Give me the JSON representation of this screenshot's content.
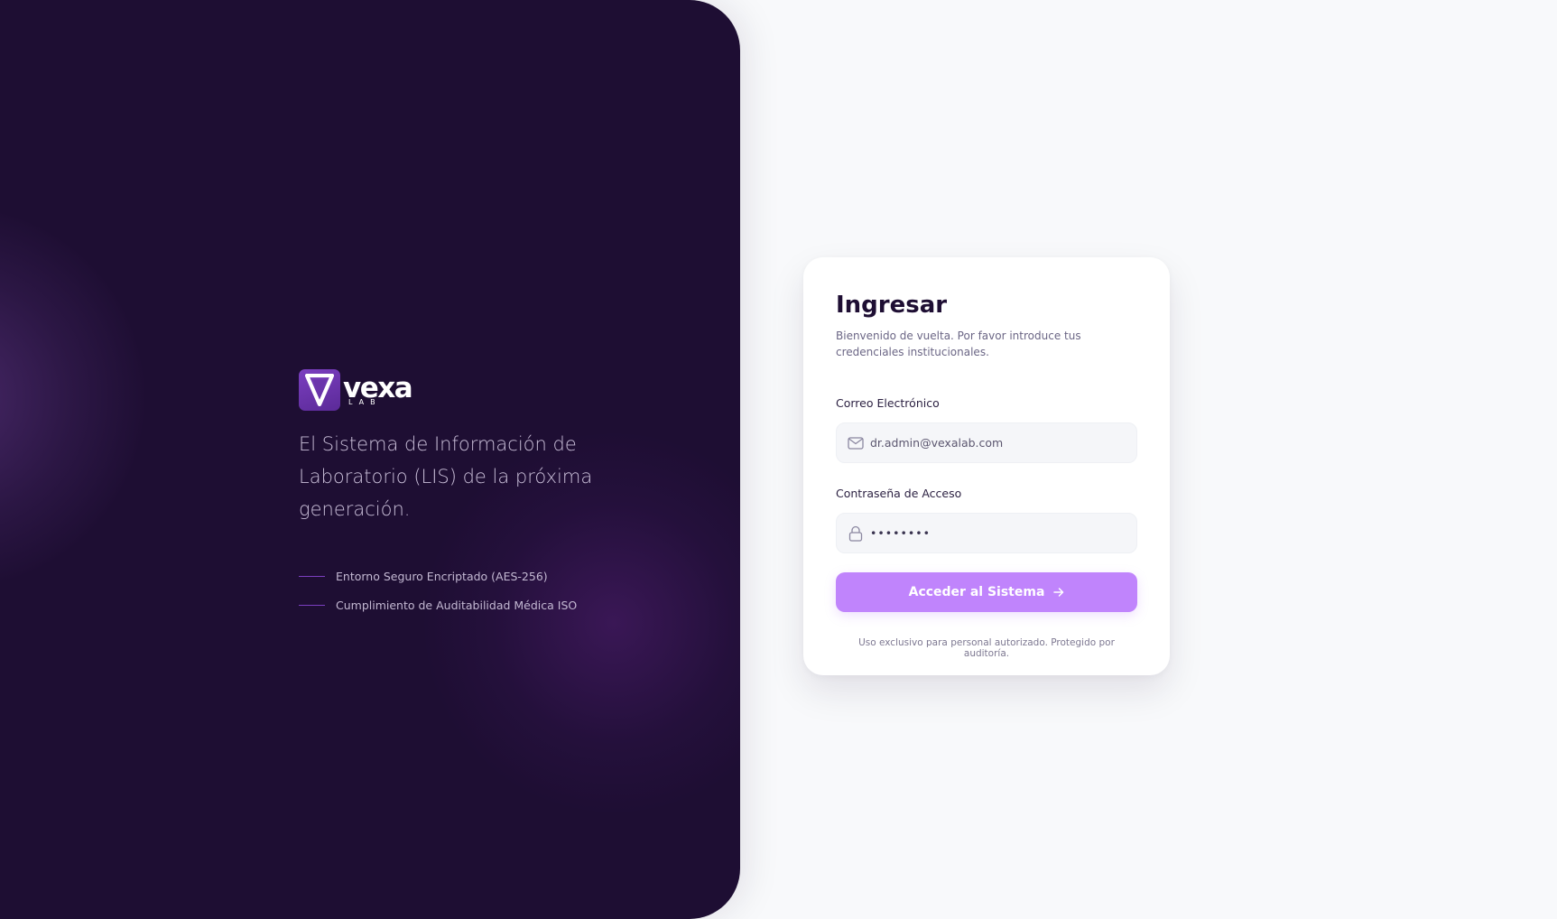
{
  "brand": {
    "logo_word": "vexa",
    "logo_sub": "LAB",
    "tagline": "El Sistema de Información de Laboratorio (LIS) de la próxima generación.",
    "features": [
      "Entorno Seguro Encriptado (AES-256)",
      "Cumplimiento de Auditabilidad Médica ISO"
    ],
    "panel_color": "#1e0e33",
    "accent_color": "#7b3fc0"
  },
  "login": {
    "title": "Ingresar",
    "subtitle": "Bienvenido de vuelta. Por favor introduce tus credenciales institucionales.",
    "email": {
      "label": "Correo Electrónico",
      "value": "dr.admin@vexalab.com",
      "icon": "mail-icon"
    },
    "password": {
      "label": "Contraseña de Acceso",
      "value": "••••••••",
      "icon": "lock-icon"
    },
    "submit_label": "Acceder al Sistema",
    "submit_icon": "arrow-right-icon",
    "submit_color": "#c084fc",
    "footnote": "Uso exclusivo para personal autorizado. Protegido por auditoría."
  }
}
